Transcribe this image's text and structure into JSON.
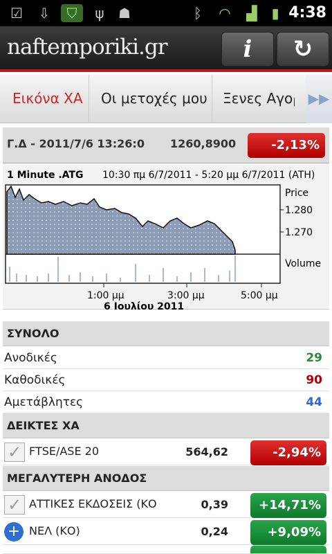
{
  "status_bar": {
    "time": "4:38",
    "icons": [
      "check-icon",
      "download-icon",
      "shield-icon",
      "usb-icon",
      "android-icon",
      "bluetooth-icon",
      "wifi-icon",
      "signal-icon",
      "battery-icon"
    ]
  },
  "app": {
    "logo": "naftemporiki.gr",
    "info_label": "i",
    "refresh_icon": "refresh-icon"
  },
  "tabs": [
    {
      "label": "Εικόνα ΧΑ",
      "active": true
    },
    {
      "label": "Οι μετοχές μου"
    },
    {
      "label": "Ξενες Αγορ"
    }
  ],
  "index": {
    "name": "Γ.Δ - 2011/7/6 13:26:0",
    "value": "1260,8900",
    "change": "-2,13%"
  },
  "chart": {
    "title": "1 Minute .ATG",
    "range": "10:30 πμ 6/7/2011 - 5:20 μμ 6/7/2011 (ATH)",
    "price_label": "Price",
    "volume_label": "Volume",
    "y_ticks": [
      "1.280",
      "1.270"
    ],
    "x_ticks": [
      "1:00 μμ",
      "3:00 μμ",
      "5:00 μμ"
    ],
    "date": "6 Ιουλίου 2011"
  },
  "summary": {
    "title": "ΣΥΝΟΛΟ",
    "rows": [
      {
        "label": "Ανοδικές",
        "value": "29",
        "color": "#2a8a3a"
      },
      {
        "label": "Καθοδικές",
        "value": "90",
        "color": "#b00000"
      },
      {
        "label": "Αμετάβλητες",
        "value": "44",
        "color": "#2a6ad0"
      }
    ]
  },
  "indices": {
    "title": "ΔΕΙΚΤΕΣ ΧΑ",
    "rows": [
      {
        "name": "FTSE/ASE 20",
        "price": "564,62",
        "change": "-2,94%"
      }
    ]
  },
  "gainers": {
    "title": "ΜΕΓΑΛΥΤΕΡΗ ΑΝΟΔΟΣ",
    "rows": [
      {
        "name": "ΑΤΤΙΚΕΣ ΕΚΔΟΣΕΙΣ (ΚΟ",
        "price": "0,39",
        "change": "+14,71%"
      },
      {
        "name": "ΝΕΛ (ΚΟ)",
        "price": "0,24",
        "change": "+9,09%"
      }
    ]
  }
}
